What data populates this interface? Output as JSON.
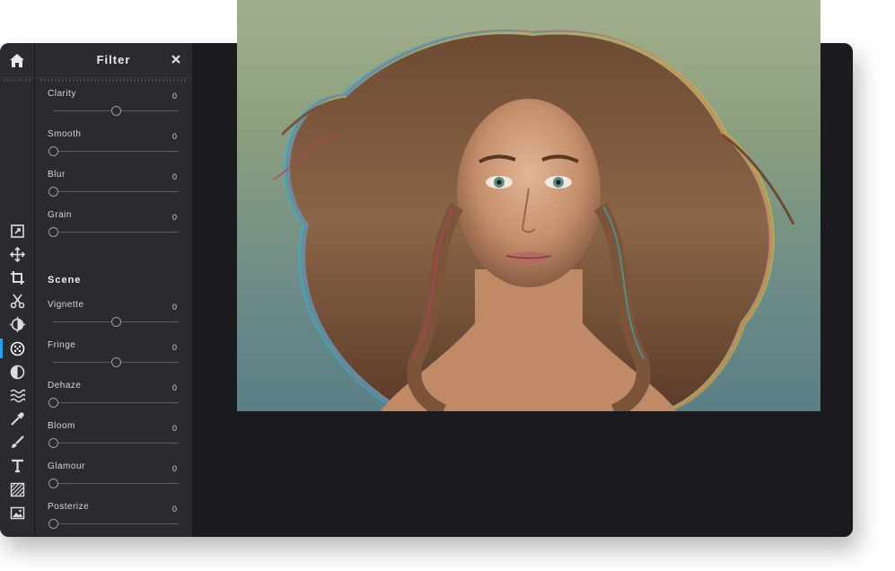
{
  "panel": {
    "title": "Filter",
    "section_scene": "Scene"
  },
  "controls": [
    {
      "label": "Clarity",
      "value": "0",
      "position": 0.5
    },
    {
      "label": "Smooth",
      "value": "0",
      "position": 0.0
    },
    {
      "label": "Blur",
      "value": "0",
      "position": 0.0
    },
    {
      "label": "Grain",
      "value": "0",
      "position": 0.0
    },
    {
      "label": "Vignette",
      "value": "0",
      "position": 0.5
    },
    {
      "label": "Fringe",
      "value": "0",
      "position": 0.5
    },
    {
      "label": "Dehaze",
      "value": "0",
      "position": 0.0
    },
    {
      "label": "Bloom",
      "value": "0",
      "position": 0.0
    },
    {
      "label": "Glamour",
      "value": "0",
      "position": 0.0
    },
    {
      "label": "Posterize",
      "value": "0",
      "position": 0.0
    }
  ],
  "tools": [
    "resize-icon",
    "move-icon",
    "crop-icon",
    "cut-icon",
    "adjust-icon",
    "filter-icon",
    "tone-icon",
    "wave-icon",
    "eyedropper-icon",
    "brush-icon",
    "text-icon",
    "hatch-icon",
    "image-icon"
  ],
  "active_tool": "filter-icon",
  "colors": {
    "accent": "#2aa1e8",
    "panel_bg": "#2a2b2f",
    "canvas_bg": "#1b1b1f"
  }
}
